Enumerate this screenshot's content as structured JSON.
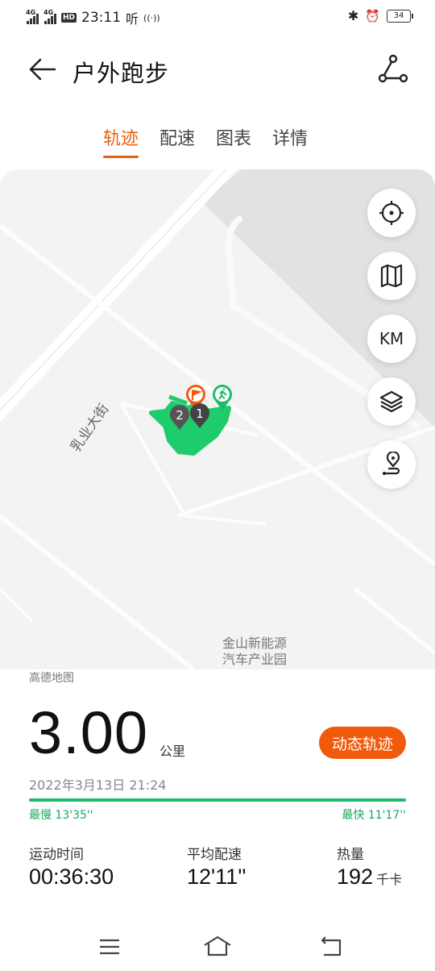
{
  "status_bar": {
    "net1": "4G",
    "net2": "4G",
    "hd": "HD",
    "time": "23:11",
    "extra": "听",
    "battery": "34"
  },
  "header": {
    "title": "户外跑步"
  },
  "tabs": [
    {
      "label": "轨迹",
      "active": true
    },
    {
      "label": "配速",
      "active": false
    },
    {
      "label": "图表",
      "active": false
    },
    {
      "label": "详情",
      "active": false
    }
  ],
  "map": {
    "street": "乳业大街",
    "poi_line1": "金山新能源",
    "poi_line2": "汽车产业园",
    "km_label": "KM",
    "marker1": "1",
    "marker2": "2",
    "source": "高德地图"
  },
  "summary": {
    "distance": "3.00",
    "distance_unit": "公里",
    "dynamic_button": "动态轨迹",
    "datetime": "2022年3月13日 21:24",
    "slowest": "最慢 13'35''",
    "fastest": "最快 11'17''"
  },
  "stats": [
    {
      "label": "运动时间",
      "value": "00:36:30",
      "unit": ""
    },
    {
      "label": "平均配速",
      "value": "12'11''",
      "unit": ""
    },
    {
      "label": "热量",
      "value": "192",
      "unit": "千卡"
    }
  ],
  "colors": {
    "accent": "#e8600c",
    "route": "#1dbb6b"
  }
}
